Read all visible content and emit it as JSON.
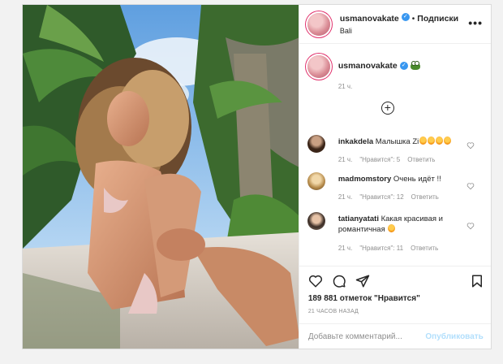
{
  "post": {
    "author": "usmanovakate",
    "follow_label": "Подписки",
    "dot": "•",
    "location": "Bali",
    "more": "•••"
  },
  "caption": {
    "author": "usmanovakate",
    "time": "21 ч."
  },
  "load_more": "+",
  "comments": [
    {
      "user": "inkakdela",
      "text": "Малышка Zi",
      "time": "21 ч.",
      "likes": "\"Нравится\": 5",
      "reply": "Ответить"
    },
    {
      "user": "madmomstory",
      "text": "Очень идёт !!",
      "time": "21 ч.",
      "likes": "\"Нравится\": 12",
      "reply": "Ответить"
    },
    {
      "user": "tatianyatati",
      "text": "Какая красивая и романтичная",
      "time": "21 ч.",
      "likes": "\"Нравится\": 11",
      "reply": "Ответить"
    }
  ],
  "stats": {
    "likes": "189 881 отметок \"Нравится\"",
    "ago": "21 ЧАСОВ НАЗАД"
  },
  "add_comment": {
    "placeholder": "Добавьте комментарий...",
    "publish": "Опубликовать"
  },
  "icons": [
    "heart-icon",
    "comment-icon",
    "share-icon",
    "save-icon",
    "verified-icon",
    "frog-emoji-icon",
    "fire-emoji-icon",
    "add-circle-icon"
  ],
  "colors": {
    "verified": "#3897f0",
    "publish_disabled": "#b2dffc",
    "meta_gray": "#8e8e8e"
  }
}
